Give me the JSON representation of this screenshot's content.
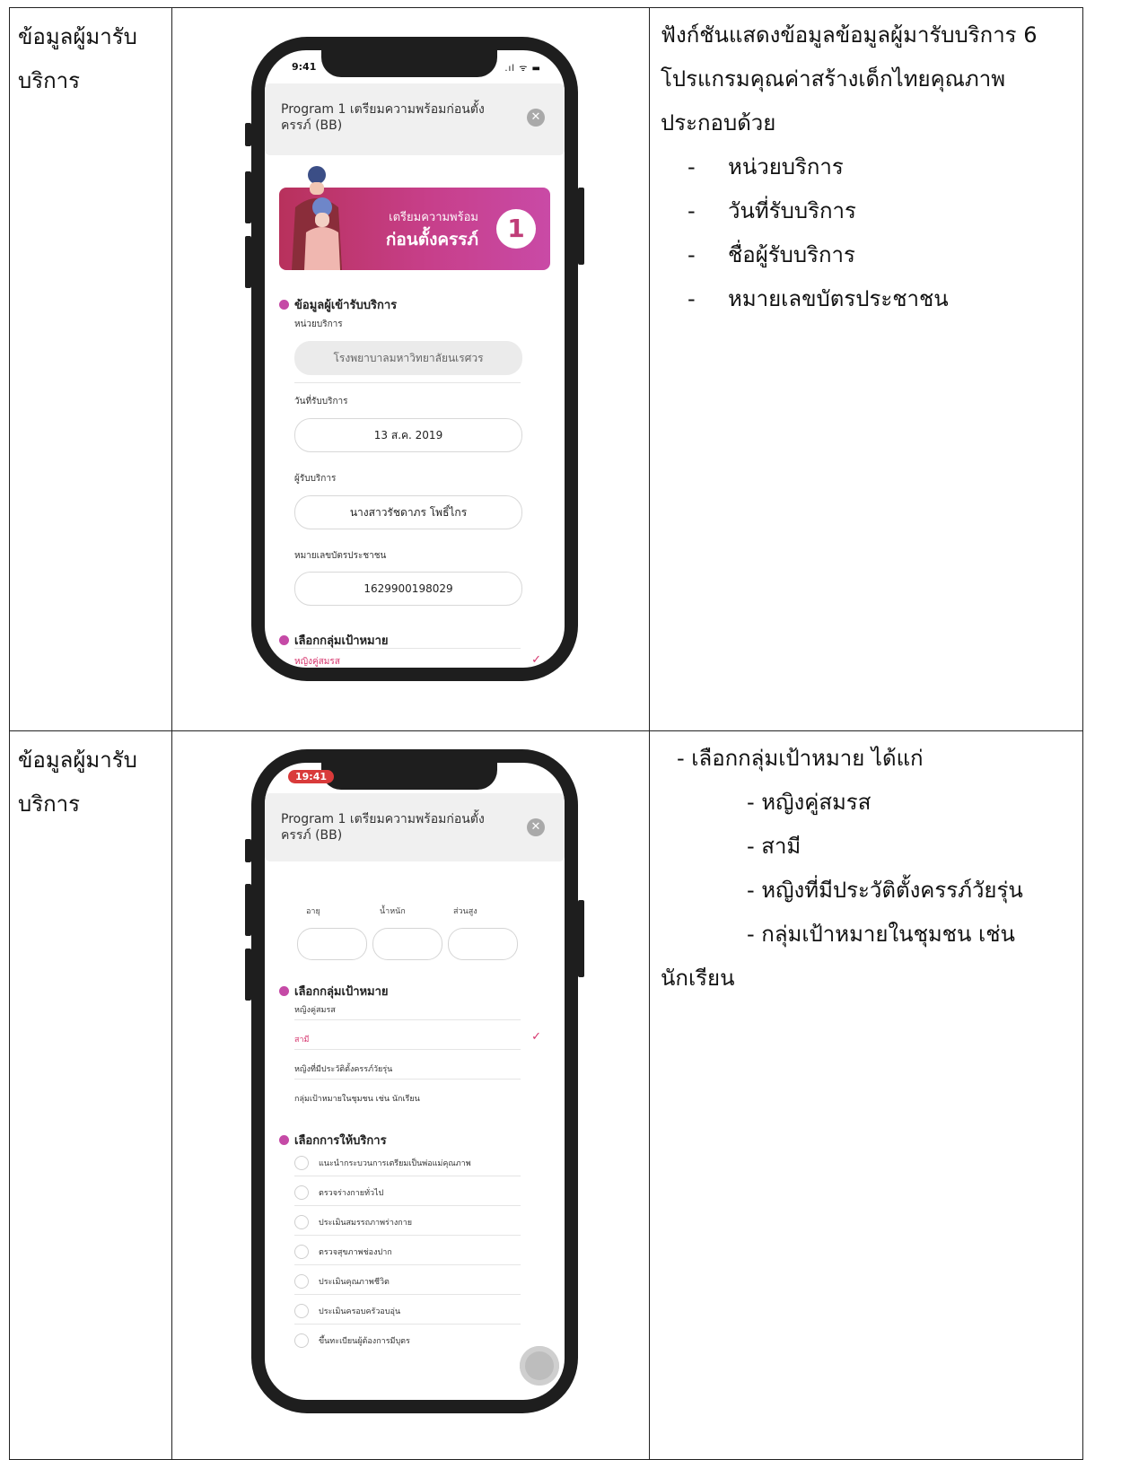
{
  "rows": [
    {
      "label_line1": "ข้อมูลผู้มารับ",
      "label_line2": "บริการ",
      "desc_line1": "ฟังก์ชันแสดงข้อมูลข้อมูลผู้มารับบริการ 6",
      "desc_line2": "โปรแกรมคุณค่าสร้างเด็กไทยคุณภาพ",
      "desc_line3": "ประกอบด้วย",
      "bullets": [
        "หน่วยบริการ",
        "วันที่รับบริการ",
        "ชื่อผู้รับบริการ",
        "หมายเลขบัตรประชาชน"
      ]
    },
    {
      "label_line1": "ข้อมูลผู้มารับ",
      "label_line2": "บริการ",
      "desc_line1": "- เลือกกลุ่มเป้าหมาย ได้แก่",
      "sub_items": [
        "- หญิงคู่สมรส",
        "- สามี",
        "- หญิงที่มีประวัติตั้งครรภ์วัยรุ่น",
        "- กลุ่มเป้าหมายในชุมชน เช่น"
      ],
      "desc_last": "นักเรียน"
    }
  ],
  "phone1": {
    "time": "9:41",
    "status_icons": ".ıl ᯤ ▬",
    "header_title": "Program 1 เตรียมความพร้อมก่อนตั้งครรภ์ (BB)",
    "banner_line1": "เตรียมความพร้อม",
    "banner_line2": "ก่อนตั้งครรภ์",
    "banner_number": "1",
    "section1_title": "ข้อมูลผู้เข้ารับบริการ",
    "unit_label": "หน่วยบริการ",
    "unit_value": "โรงพยาบาลมหาวิทยาลัยนเรศวร",
    "date_label": "วันที่รับบริการ",
    "date_value": "13 ส.ค. 2019",
    "client_label": "ผู้รับบริการ",
    "client_value": "นางสาวรัชดาภร  โพธิ์ไกร",
    "id_label": "หมายเลขบัตรประชาชน",
    "id_value": "1629900198029",
    "section2_title": "เลือกกลุ่มเป้าหมาย",
    "selected_target": "หญิงคู่สมรส"
  },
  "phone2": {
    "time": "19:41",
    "header_title": "Program 1 เตรียมความพร้อมก่อนตั้งครรภ์ (BB)",
    "age_label": "อายุ",
    "weight_label": "น้ำหนัก",
    "height_label": "ส่วนสูง",
    "section_target_title": "เลือกกลุ่มเป้าหมาย",
    "targets": [
      "หญิงคู่สมรส",
      "สามี",
      "หญิงที่มีประวัติตั้งครรภ์วัยรุ่น",
      "กลุ่มเป้าหมายในชุมชน เช่น นักเรียน"
    ],
    "section_service_title": "เลือกการให้บริการ",
    "services": [
      "แนะนำกระบวนการเตรียมเป็นพ่อแม่คุณภาพ",
      "ตรวจร่างกายทั่วไป",
      "ประเมินสมรรถภาพร่างกาย",
      "ตรวจสุขภาพช่องปาก",
      "ประเมินคุณภาพชีวิต",
      "ประเมินครอบครัวอบอุ่น",
      "ขึ้นทะเบียนผู้ต้องการมีบุตร"
    ]
  }
}
